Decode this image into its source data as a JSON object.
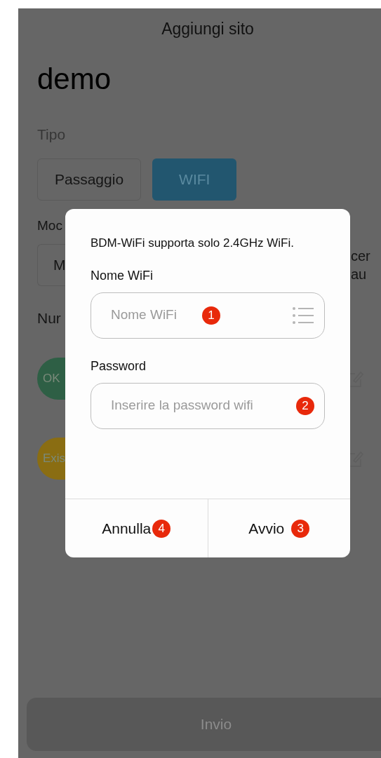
{
  "header": {
    "title": "Aggiungi sito"
  },
  "site_name": "demo",
  "type_label": "Tipo",
  "type_options": [
    {
      "label": "Passaggio",
      "selected": false
    },
    {
      "label": "WIFI",
      "selected": true
    }
  ],
  "mode_label": "Moc",
  "mode_box": "M",
  "right_texts": [
    "cer",
    "au"
  ],
  "number_label": "Nur",
  "devices": [
    {
      "status": "OK",
      "color": "#2e5f45"
    },
    {
      "status": "Exis",
      "color": "#8a6d12"
    }
  ],
  "submit": "Invio",
  "dialog": {
    "message": "BDM-WiFi supporta solo 2.4GHz WiFi.",
    "fields": [
      {
        "kind": "list",
        "label": "Nome WiFi",
        "placeholder": "Nome WiFi",
        "marker": "1"
      },
      {
        "kind": "plain",
        "label": "Password",
        "placeholder": "Inserire la password wifi",
        "marker": "2"
      }
    ],
    "buttons": [
      {
        "label": "Annulla",
        "marker": "4"
      },
      {
        "label": "Avvio",
        "marker": "3"
      }
    ]
  }
}
